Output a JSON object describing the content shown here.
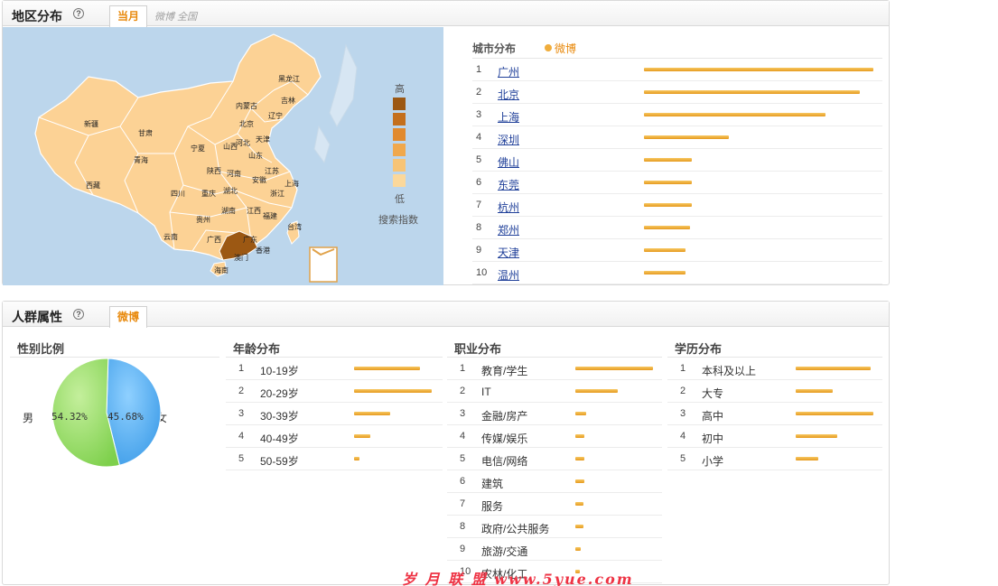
{
  "region": {
    "title": "地区分布",
    "tabs": {
      "active": "当月",
      "extra": "微博 全国"
    },
    "legend": {
      "high": "高",
      "low": "低",
      "caption": "搜索指数",
      "colors": [
        "#9c5813",
        "#c46f1c",
        "#e18a2e",
        "#f0a84c",
        "#f7c476",
        "#fbd89b"
      ]
    },
    "map_labels": [
      {
        "name": "新疆"
      },
      {
        "name": "甘肃"
      },
      {
        "name": "青海"
      },
      {
        "name": "西藏"
      },
      {
        "name": "四川"
      },
      {
        "name": "内蒙古"
      },
      {
        "name": "黑龙江"
      },
      {
        "name": "吉林"
      },
      {
        "name": "辽宁"
      },
      {
        "name": "北京"
      },
      {
        "name": "天津"
      },
      {
        "name": "河北"
      },
      {
        "name": "山西"
      },
      {
        "name": "山东"
      },
      {
        "name": "宁夏"
      },
      {
        "name": "陕西"
      },
      {
        "name": "河南"
      },
      {
        "name": "江苏"
      },
      {
        "name": "安徽"
      },
      {
        "name": "上海"
      },
      {
        "name": "湖北"
      },
      {
        "name": "重庆"
      },
      {
        "name": "浙江"
      },
      {
        "name": "贵州"
      },
      {
        "name": "湖南"
      },
      {
        "name": "江西"
      },
      {
        "name": "福建"
      },
      {
        "name": "云南"
      },
      {
        "name": "广西"
      },
      {
        "name": "广东"
      },
      {
        "name": "台湾"
      },
      {
        "name": "香港"
      },
      {
        "name": "澳门"
      },
      {
        "name": "海南"
      }
    ],
    "city_list": {
      "title": "城市分布",
      "series_name": "微博",
      "series_color": "#f0ad3c",
      "rows": [
        {
          "rank": "1",
          "city": "广州",
          "value": 1.0
        },
        {
          "rank": "2",
          "city": "北京",
          "value": 0.94
        },
        {
          "rank": "3",
          "city": "上海",
          "value": 0.79
        },
        {
          "rank": "4",
          "city": "深圳",
          "value": 0.37
        },
        {
          "rank": "5",
          "city": "佛山",
          "value": 0.21
        },
        {
          "rank": "6",
          "city": "东莞",
          "value": 0.21
        },
        {
          "rank": "7",
          "city": "杭州",
          "value": 0.21
        },
        {
          "rank": "8",
          "city": "郑州",
          "value": 0.2
        },
        {
          "rank": "9",
          "city": "天津",
          "value": 0.18
        },
        {
          "rank": "10",
          "city": "温州",
          "value": 0.18
        }
      ]
    }
  },
  "crowd": {
    "title": "人群属性",
    "tab": "微博",
    "gender": {
      "title": "性别比例",
      "male_label": "男",
      "female_label": "女",
      "male_pct": "54.32%",
      "female_pct": "45.68%",
      "male_value": 54.32,
      "female_value": 45.68,
      "male_color": "#7ed04c",
      "female_color": "#3d9ce8"
    },
    "age": {
      "title": "年龄分布",
      "rows": [
        {
          "rank": "1",
          "label": "10-19岁",
          "value": 0.85
        },
        {
          "rank": "2",
          "label": "20-29岁",
          "value": 1.0
        },
        {
          "rank": "3",
          "label": "30-39岁",
          "value": 0.46
        },
        {
          "rank": "4",
          "label": "40-49岁",
          "value": 0.21
        },
        {
          "rank": "5",
          "label": "50-59岁",
          "value": 0.07
        }
      ]
    },
    "occupation": {
      "title": "职业分布",
      "rows": [
        {
          "rank": "1",
          "label": "教育/学生",
          "value": 1.0
        },
        {
          "rank": "2",
          "label": "IT",
          "value": 0.55
        },
        {
          "rank": "3",
          "label": "金融/房产",
          "value": 0.14
        },
        {
          "rank": "4",
          "label": "传媒/娱乐",
          "value": 0.12
        },
        {
          "rank": "5",
          "label": "电信/网络",
          "value": 0.12
        },
        {
          "rank": "6",
          "label": "建筑",
          "value": 0.12
        },
        {
          "rank": "7",
          "label": "服务",
          "value": 0.11
        },
        {
          "rank": "8",
          "label": "政府/公共服务",
          "value": 0.11
        },
        {
          "rank": "9",
          "label": "旅游/交通",
          "value": 0.07
        },
        {
          "rank": "10",
          "label": "农林/化工",
          "value": 0.05
        }
      ]
    },
    "education": {
      "title": "学历分布",
      "rows": [
        {
          "rank": "1",
          "label": "本科及以上",
          "value": 0.96
        },
        {
          "rank": "2",
          "label": "大专",
          "value": 0.48
        },
        {
          "rank": "3",
          "label": "高中",
          "value": 1.0
        },
        {
          "rank": "4",
          "label": "初中",
          "value": 0.54
        },
        {
          "rank": "5",
          "label": "小学",
          "value": 0.29
        }
      ]
    }
  },
  "watermark": "岁 月 联 盟 www.5yue.com"
}
